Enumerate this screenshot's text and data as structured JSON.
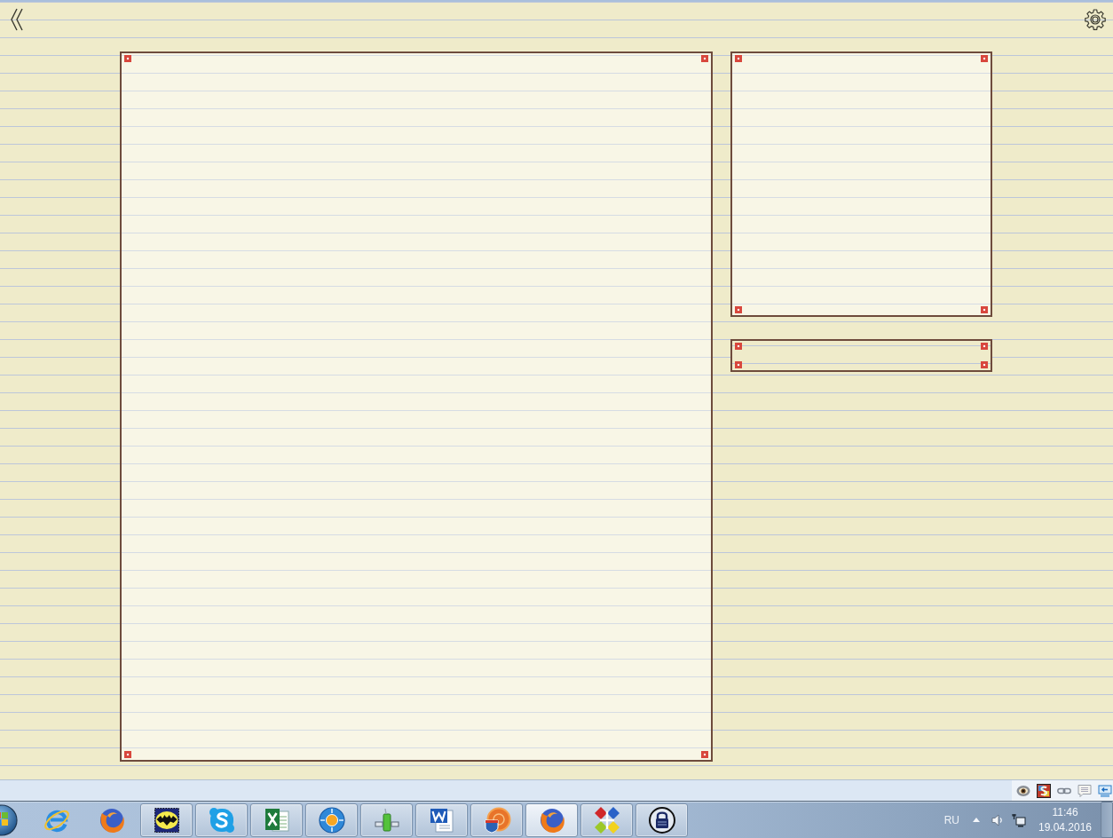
{
  "taskbar": {
    "buttons": [
      {
        "kind": "orbit",
        "running": false,
        "selected": false
      },
      {
        "kind": "fox",
        "running": false,
        "selected": false
      },
      {
        "kind": "bat",
        "running": true,
        "selected": false
      },
      {
        "kind": "cloud",
        "running": true,
        "selected": false
      },
      {
        "kind": "sheet",
        "running": true,
        "selected": false
      },
      {
        "kind": "compass",
        "running": true,
        "selected": false
      },
      {
        "kind": "tube",
        "running": true,
        "selected": false
      },
      {
        "kind": "document",
        "running": true,
        "selected": false
      },
      {
        "kind": "badge",
        "running": true,
        "selected": false
      },
      {
        "kind": "fox",
        "running": true,
        "selected": true
      },
      {
        "kind": "blocks",
        "running": true,
        "selected": false
      },
      {
        "kind": "padlock",
        "running": true,
        "selected": false
      }
    ],
    "tray": {
      "language": "RU",
      "time": "11:46",
      "date": "19.04.2016"
    }
  }
}
